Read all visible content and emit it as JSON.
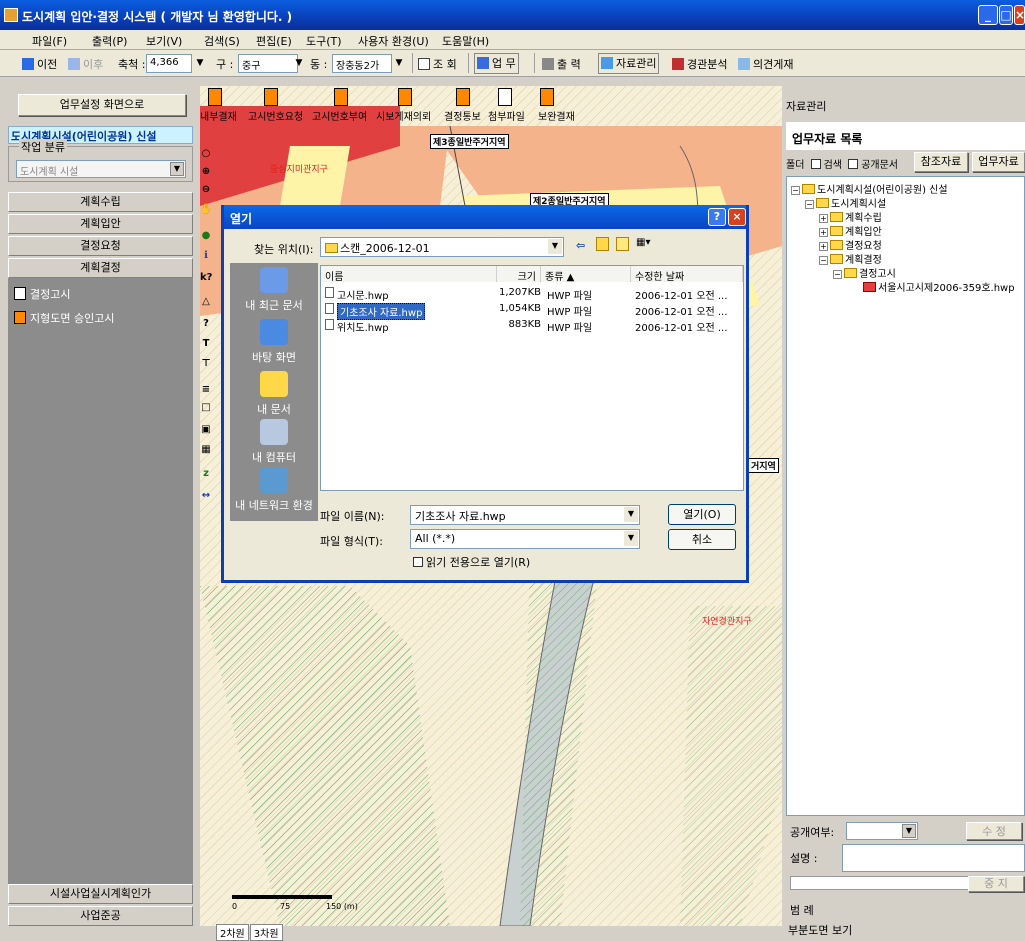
{
  "window": {
    "title": "도시계획 입안·결정 시스템 ( 개발자 님 환영합니다. )"
  },
  "menu": [
    "파일(F)",
    "출력(P)",
    "보기(V)",
    "검색(S)",
    "편집(E)",
    "도구(T)",
    "사용자 환경(U)",
    "도움말(H)"
  ],
  "toolbar": {
    "back": "이전",
    "forward": "이후",
    "scale_label": "축척 :",
    "scale_value": "4,366",
    "gu_label": "구 :",
    "gu_value": "중구",
    "dong_label": "동 :",
    "dong_value": "장충동2가",
    "query": "조 회",
    "work": "업 무",
    "print": "출 력",
    "data_mgmt": "자료관리",
    "landscape": "경관분석",
    "opinion": "의견게재"
  },
  "left": {
    "screen_button": "업무설정 화면으로",
    "selected": "도시계획시설(어린이공원) 신설",
    "group_label": "작업 분류",
    "category": "도시계획 시설",
    "nav": [
      "계획수립",
      "계획입안",
      "결정요청",
      "계획결정"
    ],
    "items": [
      "결정고시",
      "지형도면 승인고시"
    ],
    "bottom": [
      "시설사업실시계획인가",
      "사업준공"
    ]
  },
  "map_tools": [
    "내부결재",
    "고시번호요청",
    "고시번호부여",
    "시보게재의뢰",
    "결정통보",
    "첨부파일",
    "보완결재"
  ],
  "map_labels": {
    "label1": "제3종일반주거지역",
    "label2": "제2종일반주거지역",
    "label3": "거지역",
    "red1": "중심지미관지구",
    "red2": "자연경관지구",
    "scale_0": "0",
    "scale_75": "75",
    "scale_150": "150 (m)",
    "tab2d": "2차원",
    "tab3d": "3차원"
  },
  "dialog": {
    "title": "열기",
    "look_in_label": "찾는 위치(I):",
    "look_in_value": "스캔_2006-12-01",
    "places": [
      "내 최근 문서",
      "바탕 화면",
      "내 문서",
      "내 컴퓨터",
      "내 네트워크 환경"
    ],
    "columns": [
      "이름",
      "크기",
      "종류 ▲",
      "수정한 날짜"
    ],
    "files": [
      {
        "name": "고시문.hwp",
        "size": "1,207KB",
        "type": "HWP 파일",
        "date": "2006-12-01 오전 ..."
      },
      {
        "name": "기초조사 자료.hwp",
        "size": "1,054KB",
        "type": "HWP 파일",
        "date": "2006-12-01 오전 ..."
      },
      {
        "name": "위치도.hwp",
        "size": "883KB",
        "type": "HWP 파일",
        "date": "2006-12-01 오전 ..."
      }
    ],
    "filename_label": "파일 이름(N):",
    "filename_value": "기초조사 자료.hwp",
    "filetype_label": "파일 형식(T):",
    "filetype_value": "All (*.*)",
    "readonly_label": "읽기 전용으로 열기(R)",
    "open_button": "열기(O)",
    "cancel_button": "취소"
  },
  "right": {
    "header": "자료관리",
    "list_title": "업무자료 목록",
    "folder_label": "폴더",
    "search_label": "검색",
    "public_label": "공개문서",
    "ref_button": "참조자료",
    "work_button": "업무자료",
    "tree": [
      "도시계획시설(어린이공원) 신설",
      "도시계획시설",
      "계획수립",
      "계획입안",
      "결정요청",
      "계획결정",
      "결정고시",
      "서울시고시제2006-359호.hwp"
    ],
    "public_flag_label": "공개여부:",
    "edit_button": "수 정",
    "desc_label": "설명 :",
    "stop_button": "중 지",
    "legend": "범 례",
    "partial_view": "부분도면 보기"
  }
}
